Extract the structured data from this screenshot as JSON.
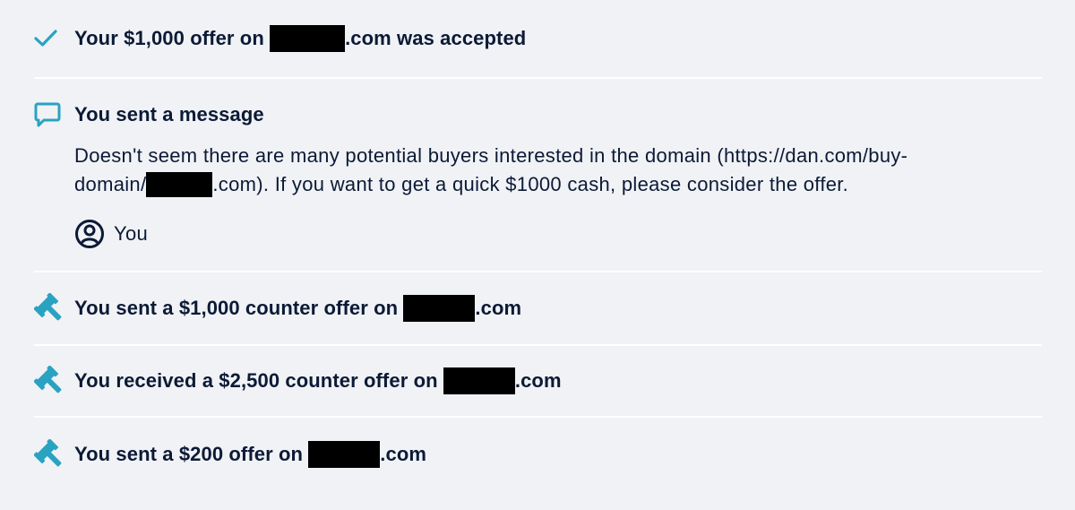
{
  "events": [
    {
      "type": "accepted",
      "icon": "check-icon",
      "prefix": "Your $1,000 offer on",
      "suffix": ".com was accepted"
    },
    {
      "type": "message",
      "icon": "chat-bubble-icon",
      "title": "You sent a message",
      "line1": "Doesn't seem there are many potential buyers interested in the domain (https://dan.com/buy-",
      "line2_prefix": "domain/",
      "line2_suffix": ".com). If you want to get a quick $1000 cash, please consider the offer.",
      "author": "You"
    },
    {
      "type": "counter_sent",
      "icon": "gavel-icon",
      "prefix": "You sent a $1,000 counter offer on",
      "suffix": ".com"
    },
    {
      "type": "counter_received",
      "icon": "gavel-icon",
      "prefix": "You received a $2,500 counter offer on",
      "suffix": ".com"
    },
    {
      "type": "offer_sent",
      "icon": "gavel-icon",
      "prefix": "You sent a $200 offer on",
      "suffix": ".com"
    }
  ],
  "colors": {
    "background": "#f0f2f5",
    "accent": "#2aa2c1",
    "text": "#0c1a36",
    "divider": "#ffffff",
    "redaction": "#000000"
  }
}
